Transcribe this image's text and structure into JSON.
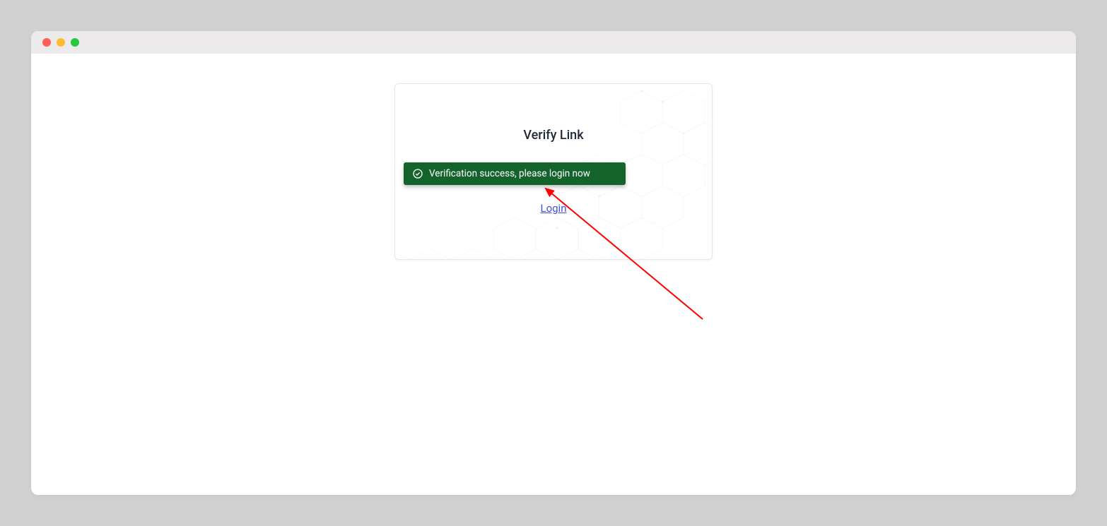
{
  "card": {
    "title": "Verify Link",
    "alert_message": "Verification success, please login now",
    "login_link_label": "Login"
  },
  "colors": {
    "alert_bg": "#14632b",
    "link": "#3f51d6"
  }
}
